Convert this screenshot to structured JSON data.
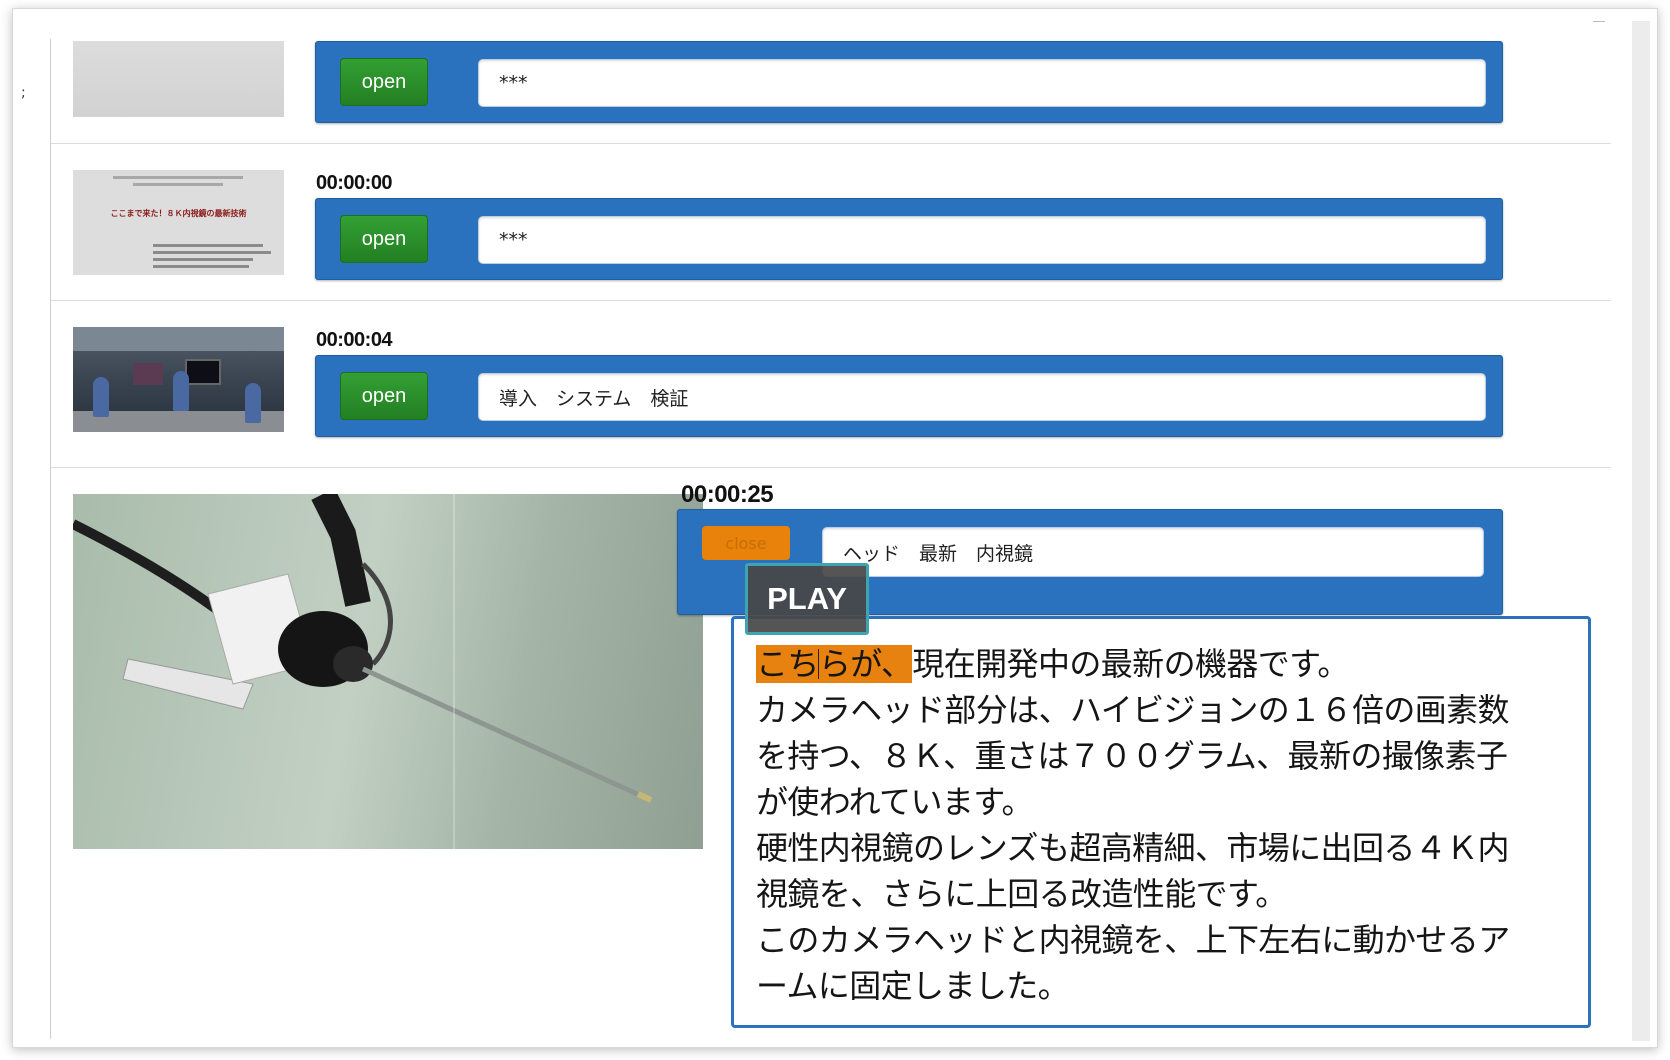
{
  "window": {
    "side_glyph": ";"
  },
  "rows": [
    {
      "timestamp": "",
      "button_label": "open",
      "keywords": "***"
    },
    {
      "timestamp": "00:00:00",
      "button_label": "open",
      "keywords": "***",
      "thumbnail_title": "ここまで来た！８Ｋ内視鏡の最新技術"
    },
    {
      "timestamp": "00:00:04",
      "button_label": "open",
      "keywords": "導入　システム　検証"
    },
    {
      "timestamp": "00:00:25",
      "button_label": "close",
      "keywords": "ヘッド　最新　内視鏡",
      "overlay_label": "PLAY",
      "transcript": {
        "highlight_a": "こち",
        "highlight_b": "らが、",
        "line1_rest": "現在開発中の最新の機器です。",
        "lines": [
          "カメラヘッド部分は、ハイビジョンの１６倍の画素数",
          "を持つ、８Ｋ、重さは７００グラム、最新の撮像素子",
          "が使われています。",
          "硬性内視鏡のレンズも超高精細、市場に出回る４Ｋ内",
          "視鏡を、さらに上回る改造性能です。",
          "このカメラヘッドと内視鏡を、上下左右に動かせるア",
          "ームに固定しました。"
        ]
      }
    }
  ],
  "colors": {
    "bar_blue": "#2a72bd",
    "open_green": "#2a8f2a",
    "close_orange": "#e8820b",
    "highlight_orange": "#e7810f",
    "overlay_border": "#3fa3b2"
  }
}
